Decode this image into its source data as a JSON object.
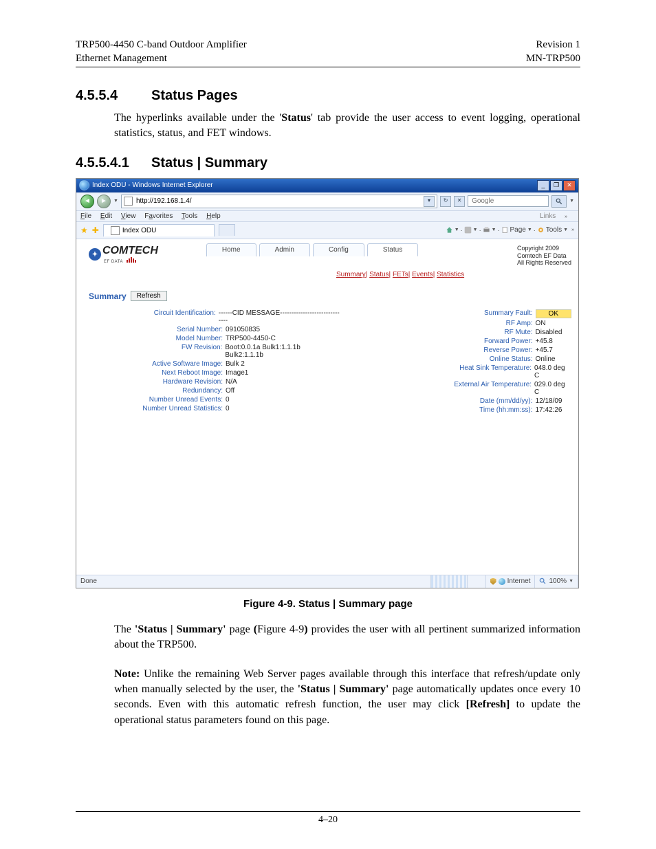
{
  "header": {
    "left1": "TRP500-4450 C-band Outdoor Amplifier",
    "left2": "Ethernet Management",
    "right1": "Revision 1",
    "right2": "MN-TRP500"
  },
  "section1": {
    "num": "4.5.5.4",
    "title": "Status Pages"
  },
  "p1a": "The hyperlinks available under the '",
  "p1b": "Status",
  "p1c": "' tab provide the user access to event logging, operational statistics, status, and FET windows.",
  "section2": {
    "num": "4.5.5.4.1",
    "title": "Status | Summary"
  },
  "ie": {
    "title_prefix": "Index ODU - Windows Internet Explorer",
    "address": "http://192.168.1.4/",
    "search_placeholder": "Google",
    "menus": {
      "file": "File",
      "edit": "Edit",
      "view": "View",
      "favorites": "Favorites",
      "tools": "Tools",
      "help": "Help",
      "links": "Links"
    },
    "tab_label": "Index ODU",
    "toolbar": {
      "page": "Page",
      "tools": "Tools"
    },
    "brand": {
      "name": "COMTECH",
      "sub": "EF DATA"
    },
    "copyright": {
      "l1": "Copyright 2009",
      "l2": "Comtech EF Data",
      "l3": "All Rights Reserved"
    },
    "page_tabs": {
      "home": "Home",
      "admin": "Admin",
      "config": "Config",
      "status": "Status"
    },
    "subtabs": {
      "summary": "Summary",
      "status": "Status",
      "fets": "FETs",
      "events": "Events",
      "statistics": "Statistics"
    },
    "summary_label": "Summary",
    "refresh": "Refresh",
    "left": [
      {
        "k": "Circuit Identification:",
        "v": "------CID MESSAGE------------------------------"
      },
      {
        "k": "Serial Number:",
        "v": "091050835"
      },
      {
        "k": "Model Number:",
        "v": "TRP500-4450-C"
      },
      {
        "k": "FW Revision:",
        "v": "Boot:0.0.1a Bulk1:1.1.1b Bulk2:1.1.1b"
      },
      {
        "k": "Active Software Image:",
        "v": "Bulk 2"
      },
      {
        "k": "Next Reboot Image:",
        "v": "Image1"
      },
      {
        "k": "Hardware Revision:",
        "v": "N/A"
      },
      {
        "k": "Redundancy:",
        "v": "Off"
      },
      {
        "k": "Number Unread Events:",
        "v": "0"
      },
      {
        "k": "Number Unread Statistics:",
        "v": "0"
      }
    ],
    "right": [
      {
        "k": "Summary Fault:",
        "v": "OK",
        "badge": true
      },
      {
        "k": "RF Amp:",
        "v": "ON"
      },
      {
        "k": "RF Mute:",
        "v": "Disabled"
      },
      {
        "k": "Forward Power:",
        "v": "+45.8"
      },
      {
        "k": "Reverse Power:",
        "v": "+45.7"
      },
      {
        "k": "Online Status:",
        "v": "Online"
      },
      {
        "k": "Heat Sink Temperature:",
        "v": "048.0 deg C"
      },
      {
        "k": "External Air Temperature:",
        "v": "029.0 deg C"
      },
      {
        "k": "Date (mm/dd/yy):",
        "v": "12/18/09"
      },
      {
        "k": "Time (hh:mm:ss):",
        "v": "17:42:26"
      }
    ],
    "status": {
      "done": "Done",
      "zone": "Internet",
      "zoom": "100%"
    }
  },
  "figure": "Figure 4-9. Status | Summary page",
  "p2": {
    "a": "The ",
    "b": "'Status | Summary'",
    "c": " page ",
    "d": "(",
    "e": "Figure 4-9",
    "f": ")",
    "g": " provides the user with all pertinent summarized information about the TRP500."
  },
  "p3": {
    "a": "Note:",
    "b": " Unlike the remaining Web Server pages available through this interface that refresh/update only when manually selected by the user, the ",
    "c": "'Status | Summary'",
    "d": " page automatically updates once every 10 seconds. Even with this automatic refresh function, the user may click ",
    "e": "[Refresh]",
    "f": " to update the operational status parameters found on this page."
  },
  "pagenum": "4–20"
}
